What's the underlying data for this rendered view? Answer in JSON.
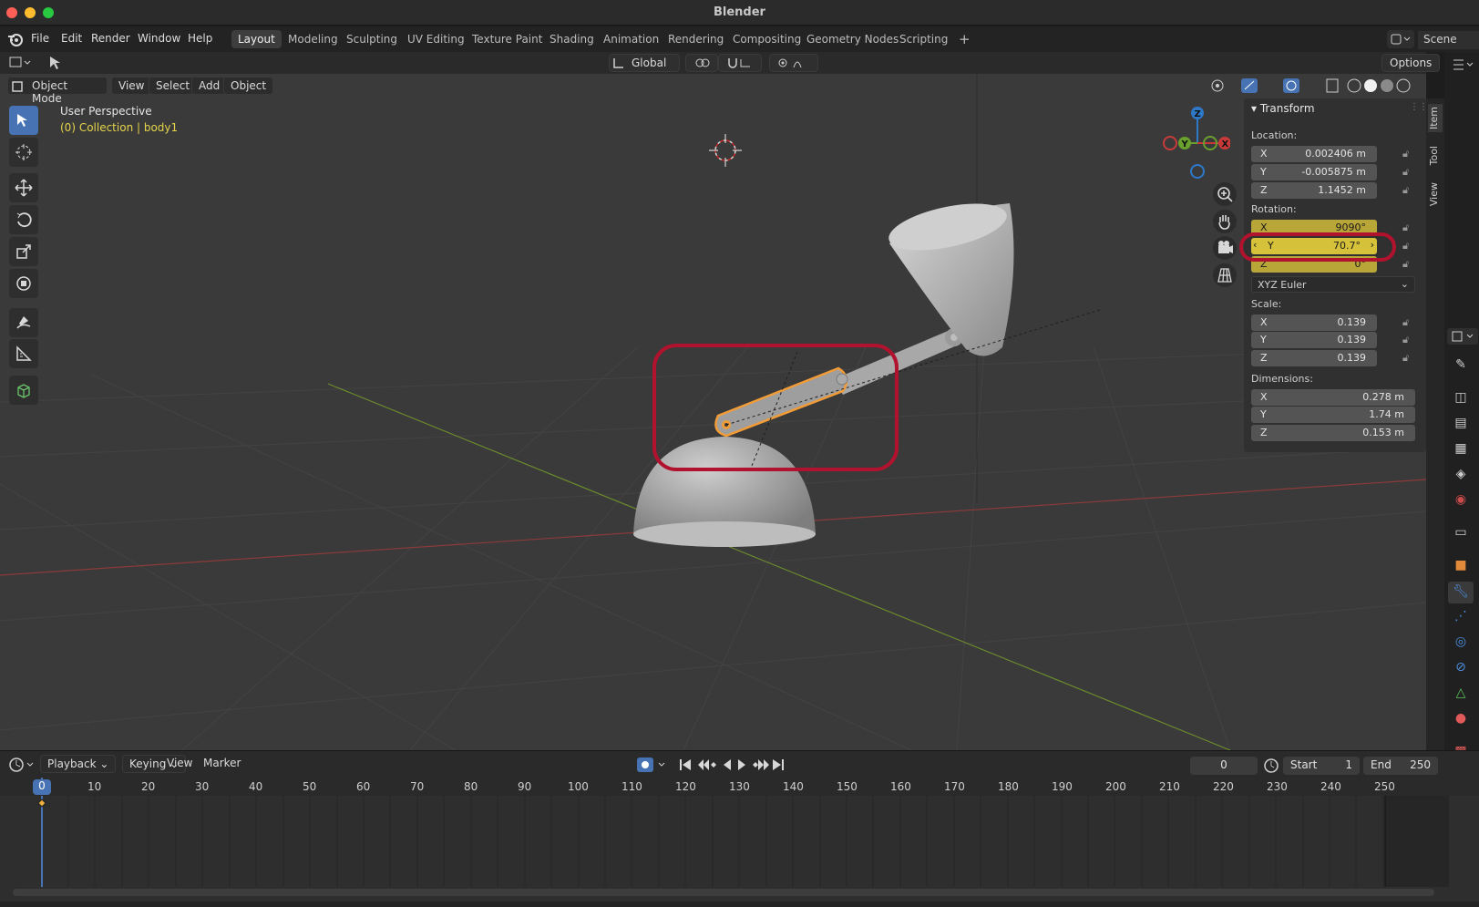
{
  "window": {
    "title": "Blender"
  },
  "menu": {
    "items": [
      "File",
      "Edit",
      "Render",
      "Window",
      "Help"
    ],
    "workspaces": [
      "Layout",
      "Modeling",
      "Sculpting",
      "UV Editing",
      "Texture Paint",
      "Shading",
      "Animation",
      "Rendering",
      "Compositing",
      "Geometry Nodes",
      "Scripting"
    ],
    "add_tab": "+",
    "scene": "Scene"
  },
  "header2": {
    "orientation": "Global",
    "options": "Options"
  },
  "viewport_header": {
    "mode": "Object Mode",
    "menus": [
      "View",
      "Select",
      "Add",
      "Object"
    ]
  },
  "viewport_info": {
    "perspective": "User Perspective",
    "collection": "(0) Collection | body1"
  },
  "gizmo": {
    "x": "X",
    "y": "Y",
    "z": "Z"
  },
  "npanel": {
    "section": "Transform",
    "location_label": "Location:",
    "location": [
      {
        "axis": "X",
        "value": "0.002406 m"
      },
      {
        "axis": "Y",
        "value": "-0.005875 m"
      },
      {
        "axis": "Z",
        "value": "1.1452 m"
      }
    ],
    "rotation_label": "Rotation:",
    "rotation": [
      {
        "axis": "X",
        "value": "9090°"
      },
      {
        "axis": "Y",
        "value": "70.7°"
      },
      {
        "axis": "Z",
        "value": "0°"
      }
    ],
    "rotation_mode": "XYZ Euler",
    "scale_label": "Scale:",
    "scale": [
      {
        "axis": "X",
        "value": "0.139"
      },
      {
        "axis": "Y",
        "value": "0.139"
      },
      {
        "axis": "Z",
        "value": "0.139"
      }
    ],
    "dimensions_label": "Dimensions:",
    "dimensions": [
      {
        "axis": "X",
        "value": "0.278 m"
      },
      {
        "axis": "Y",
        "value": "1.74 m"
      },
      {
        "axis": "Z",
        "value": "0.153 m"
      }
    ]
  },
  "side_tabs": [
    "Item",
    "Tool",
    "View"
  ],
  "timeline": {
    "menus": [
      "Playback",
      "Keying",
      "View",
      "Marker"
    ],
    "current_frame": "0",
    "start_label": "Start",
    "start": "1",
    "end_label": "End",
    "end": "250",
    "ticks": [
      "0",
      "10",
      "20",
      "30",
      "40",
      "50",
      "60",
      "70",
      "80",
      "90",
      "100",
      "110",
      "120",
      "130",
      "140",
      "150",
      "160",
      "170",
      "180",
      "190",
      "200",
      "210",
      "220",
      "230",
      "240",
      "250"
    ]
  },
  "colors": {
    "accent": "#4772b3",
    "selection": "#f29c38",
    "highlight_ring": "#b1122e",
    "rotation_field": "#d6c13a"
  }
}
